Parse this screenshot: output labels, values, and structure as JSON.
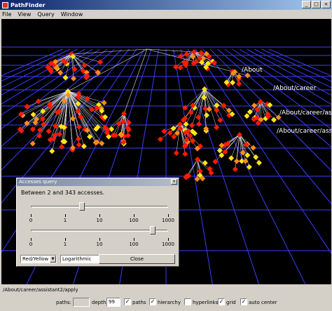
{
  "window": {
    "title": "PathFinder",
    "minimize": "_",
    "maximize": "□",
    "close": "×"
  },
  "menu": [
    "File",
    "View",
    "Query",
    "Window"
  ],
  "scene": {
    "labels": [
      "/About",
      "/About/career",
      "/About/career/assistant",
      "/About/career/assis"
    ]
  },
  "dialog": {
    "title": "Accesses query",
    "close": "×",
    "range_text": "Between 2 and 343 accesses.",
    "slider_min_level": 0.37,
    "slider_max_level": 0.89,
    "tick_labels": [
      "0",
      "1",
      "10",
      "100",
      "1000"
    ],
    "color_scheme": "Red/Yellow",
    "scale": "Logarithmic",
    "close_button": "Close"
  },
  "status_path": "/About/career/assistant2/apply",
  "controls": {
    "paths_label": "paths:",
    "paths_value": "",
    "depth_label": "depth:",
    "depth_value": "99",
    "checkboxes": [
      {
        "label": "paths",
        "checked": true
      },
      {
        "label": "hierarchy",
        "checked": true
      },
      {
        "label": "hyperlinks",
        "checked": false
      },
      {
        "label": "grid",
        "checked": true
      },
      {
        "label": "auto center",
        "checked": true
      }
    ],
    "check_mark": "✓"
  },
  "colors": {
    "grid": "#3c3cff",
    "node_red": "#ff1a00",
    "node_yellow": "#ffe61a",
    "node_orange": "#ff8c1a",
    "edge": "#e8e8e8"
  }
}
